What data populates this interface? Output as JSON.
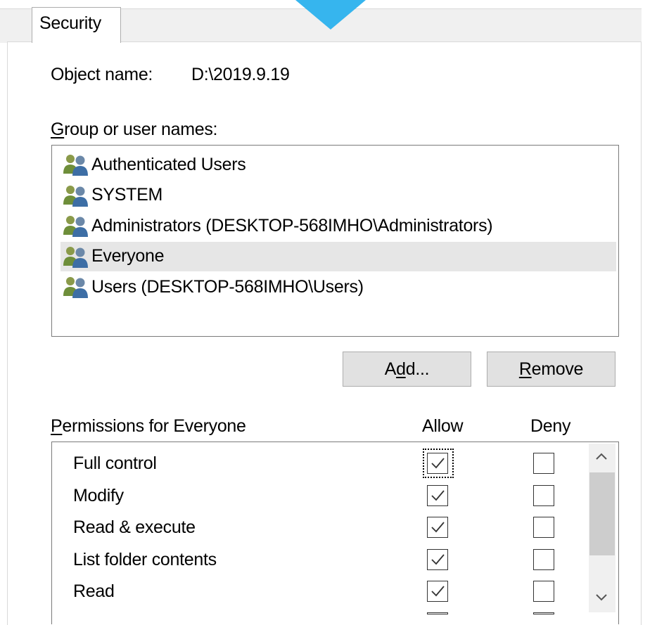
{
  "tab": {
    "label": "Security"
  },
  "object": {
    "label": "Object name:",
    "value": "D:\\2019.9.19"
  },
  "groups": {
    "label_prefix": "G",
    "label_rest": "roup or user names:",
    "items": [
      {
        "name": "Authenticated Users",
        "selected": false
      },
      {
        "name": "SYSTEM",
        "selected": false
      },
      {
        "name": "Administrators (DESKTOP-568IMHO\\Administrators)",
        "selected": false
      },
      {
        "name": "Everyone",
        "selected": true
      },
      {
        "name": "Users (DESKTOP-568IMHO\\Users)",
        "selected": false
      }
    ]
  },
  "buttons": {
    "add_pre": "A",
    "add_ul": "d",
    "add_post": "d...",
    "remove_ul": "R",
    "remove_post": "emove"
  },
  "permissions": {
    "label_ul": "P",
    "label_rest": "ermissions for Everyone",
    "allow_header": "Allow",
    "deny_header": "Deny",
    "rows": [
      {
        "name": "Full control",
        "allow": true,
        "deny": false
      },
      {
        "name": "Modify",
        "allow": true,
        "deny": false
      },
      {
        "name": "Read & execute",
        "allow": true,
        "deny": false
      },
      {
        "name": "List folder contents",
        "allow": true,
        "deny": false
      },
      {
        "name": "Read",
        "allow": true,
        "deny": false
      }
    ]
  },
  "colors": {
    "accent_cursor": "#36b5ee",
    "selection": "#e6e6e6",
    "button": "#e1e1e1"
  }
}
